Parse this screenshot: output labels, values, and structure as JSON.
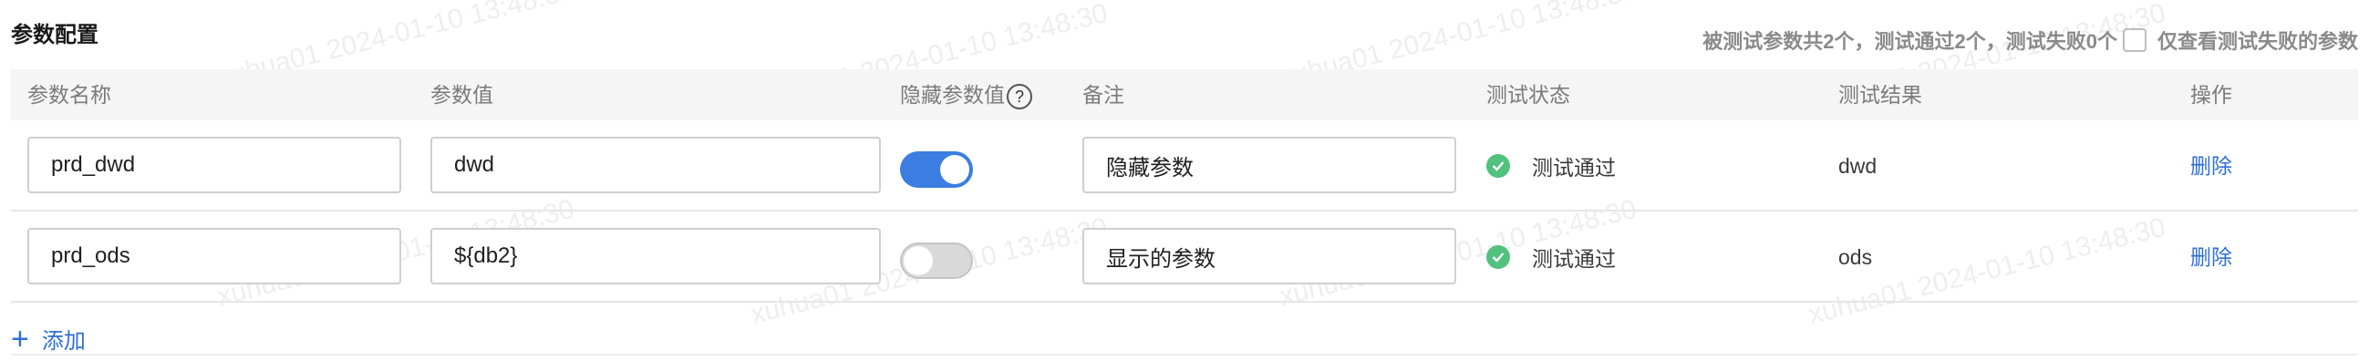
{
  "title": "参数配置",
  "summary": {
    "text": "被测试参数共2个，测试通过2个，测试失败0个",
    "filter_label": "仅查看测试失败的参数",
    "filter_checked": false
  },
  "columns": {
    "name": "参数名称",
    "value": "参数值",
    "hidden": "隐藏参数值",
    "hidden_help": "?",
    "remark": "备注",
    "status": "测试状态",
    "result": "测试结果",
    "action": "操作"
  },
  "rows": [
    {
      "name": "prd_dwd",
      "value": "dwd",
      "hidden": true,
      "remark": "隐藏参数",
      "status": "测试通过",
      "result": "dwd",
      "action": "删除"
    },
    {
      "name": "prd_ods",
      "value": "${db2}",
      "hidden": false,
      "remark": "显示的参数",
      "status": "测试通过",
      "result": "ods",
      "action": "删除"
    }
  ],
  "add_label": "添加",
  "status_color": "#52c17e",
  "accent_color": "#3b7de0",
  "watermark": "xuhua01 2024-01-10 13:48:30"
}
